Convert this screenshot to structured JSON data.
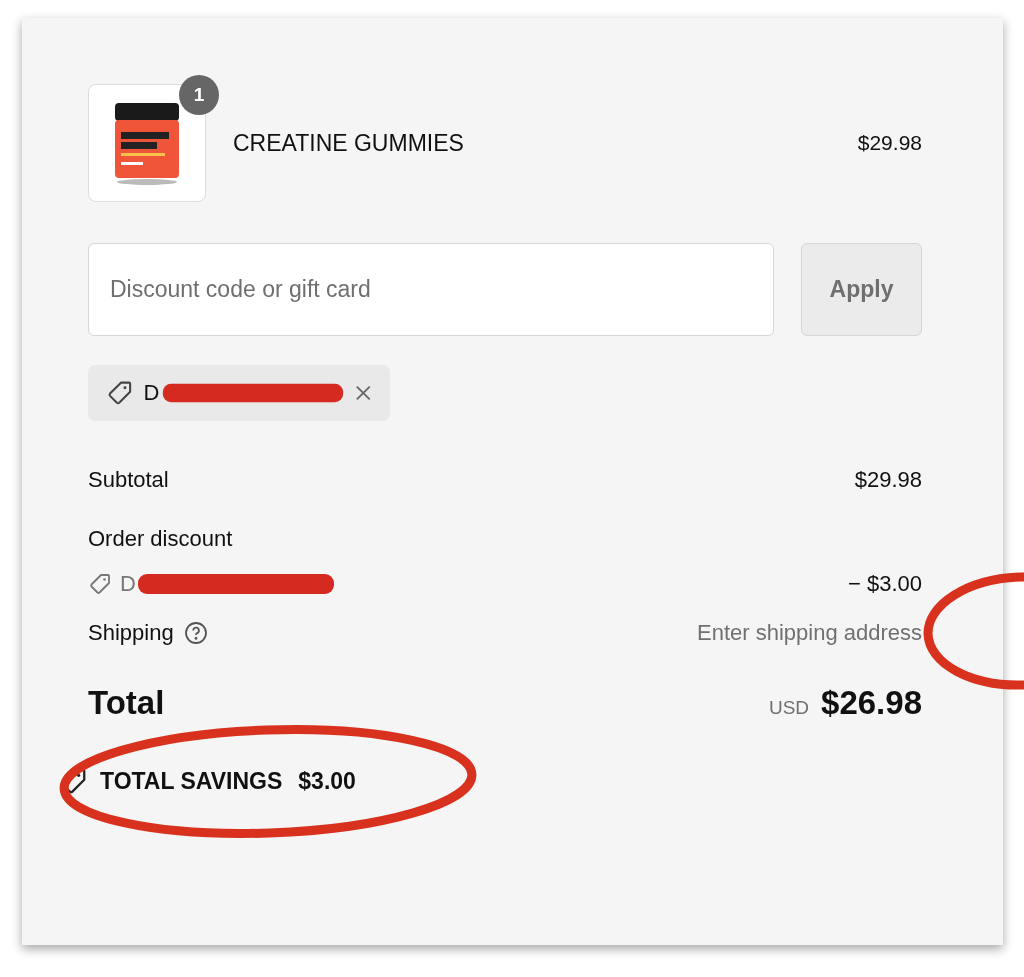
{
  "product": {
    "name": "CREATINE GUMMIES",
    "price": "$29.98",
    "quantity": "1"
  },
  "discount": {
    "placeholder": "Discount code or gift card",
    "button": "Apply"
  },
  "applied_code": {
    "code": "D"
  },
  "summary": {
    "subtotal_label": "Subtotal",
    "subtotal": "$29.98",
    "discount_label": "Order discount",
    "discount_code": "D",
    "discount_amount": "− $3.00",
    "shipping_label": "Shipping",
    "shipping_value": "Enter shipping address",
    "total_label": "Total",
    "currency": "USD",
    "total": "$26.98"
  },
  "savings": {
    "label": "TOTAL SAVINGS",
    "amount": "$3.00"
  }
}
